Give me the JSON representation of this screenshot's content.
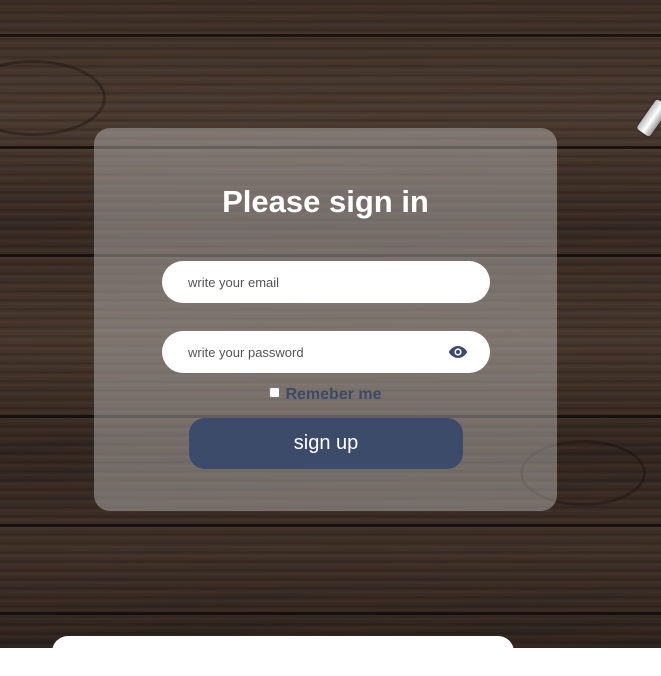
{
  "login": {
    "title": "Please sign in",
    "email_placeholder": "write your email",
    "password_placeholder": "write your password",
    "remember_label": "Remeber me",
    "remember_checked": false,
    "submit_label": "sign up",
    "accent_color": "#3c4b69",
    "icons": {
      "password_toggle": "eye-icon"
    }
  }
}
